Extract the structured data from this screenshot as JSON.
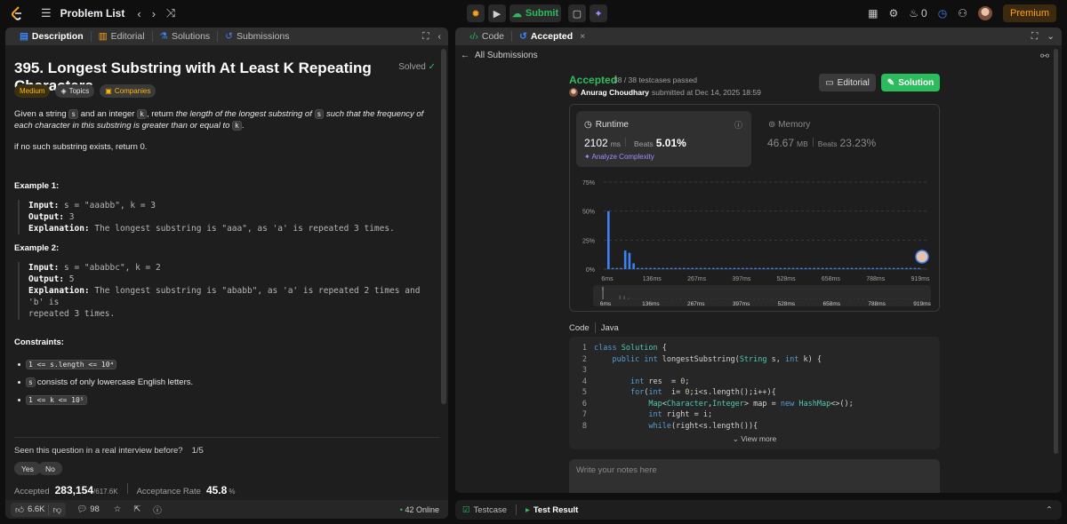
{
  "topbar": {
    "title": "Problem List",
    "submit": "Submit",
    "streak": "0",
    "premium": "Premium"
  },
  "left": {
    "tabs": [
      "Description",
      "Editorial",
      "Solutions",
      "Submissions"
    ],
    "title": "395. Longest Substring with At Least K Repeating Characters",
    "solved": "Solved",
    "chips": [
      "Medium",
      "Topics",
      "Companies"
    ],
    "desc": {
      "p1a": "Given a string ",
      "p1b": "s",
      "p1c": " and an integer ",
      "p1d": "k",
      "p1e": ", return ",
      "p1f": "the length of the longest substring of ",
      "p1g": "s",
      "p1h": " such that the frequency of each character in this substring is greater than or equal to ",
      "p1i": "k",
      "p1j": ".",
      "p2": "if no such substring exists, return 0."
    },
    "ex1": {
      "h": "Example 1:",
      "in_l": "Input:",
      "in_v": " s = \"aaabb\", k = 3",
      "out_l": "Output:",
      "out_v": " 3",
      "exp_l": "Explanation:",
      "exp_v": " The longest substring is \"aaa\", as 'a' is repeated 3 times."
    },
    "ex2": {
      "h": "Example 2:",
      "in_l": "Input:",
      "in_v": " s = \"ababbc\", k = 2",
      "out_l": "Output:",
      "out_v": " 5",
      "exp_l": "Explanation:",
      "exp_v": " The longest substring is \"ababb\", as 'a' is repeated 2 times and 'b' is",
      "exp_v2": "repeated 3 times."
    },
    "constraints_h": "Constraints:",
    "c1": "1 <= s.length <= 10⁴",
    "c2a": "s",
    "c2b": " consists of only lowercase English letters.",
    "c3": "1 <= k <= 10⁵",
    "seen": "Seen this question in a real interview before?",
    "seen_ct": "1/5",
    "yes": "Yes",
    "no": "No",
    "accepted_l": "Accepted",
    "accepted_v": "283,154",
    "accepted_t": "/617.6K",
    "rate_l": "Acceptance Rate",
    "rate_v": "45.8",
    "rate_u": "%",
    "likes": "6.6K",
    "comments": "98",
    "online": "42 Online"
  },
  "right": {
    "tabs": [
      "Code",
      "Accepted"
    ],
    "all_submissions": "All Submissions",
    "accepted": "Accepted",
    "passed": "38 / 38 testcases passed",
    "author": "Anurag Choudhary",
    "submitted": "submitted at Dec 14, 2025 18:59",
    "editorial_btn": "Editorial",
    "solution_btn": "Solution",
    "runtime": {
      "label": "Runtime",
      "value": "2102",
      "unit": "ms",
      "beats": "Beats",
      "pct": "5.01%",
      "analyze": "Analyze Complexity"
    },
    "memory": {
      "label": "Memory",
      "value": "46.67",
      "unit": "MB",
      "beats": "Beats",
      "pct": "23.23%"
    },
    "code_label": "Code",
    "lang": "Java",
    "code": [
      "class Solution {",
      "    public int longestSubstring(String s, int k) {",
      "",
      "        int res  = 0;",
      "        for(int  i= 0;i<s.length();i++){",
      "            Map<Character,Integer> map = new HashMap<>();",
      "            int right = i;",
      "            while(right<s.length()){"
    ],
    "view_more": "View more",
    "notes_ph": "Write your notes here"
  },
  "bottom": {
    "tabs": [
      "Testcase",
      "Test Result"
    ]
  },
  "chart_data": {
    "type": "bar",
    "title": "",
    "yticks": [
      "75%",
      "50%",
      "25%",
      "0%"
    ],
    "ylim": [
      0,
      75
    ],
    "xticks": [
      "6ms",
      "136ms",
      "267ms",
      "397ms",
      "528ms",
      "658ms",
      "788ms",
      "919ms"
    ],
    "values": [
      50,
      1,
      1,
      1,
      16,
      14,
      5,
      1,
      1,
      1,
      1,
      1,
      1,
      1,
      1,
      1,
      1,
      1,
      1,
      1,
      1,
      1,
      1,
      1,
      1,
      1,
      1,
      1,
      1,
      1,
      1,
      1,
      1,
      1,
      1,
      1,
      1,
      1,
      1,
      1,
      1,
      1,
      1,
      1,
      1,
      1,
      1,
      1,
      1,
      1,
      1,
      1,
      1,
      1,
      1,
      1,
      1,
      1,
      1,
      1,
      1,
      1,
      1,
      1,
      1,
      1,
      1,
      1,
      1,
      1,
      1,
      1,
      1,
      1,
      1
    ],
    "grid": true
  }
}
